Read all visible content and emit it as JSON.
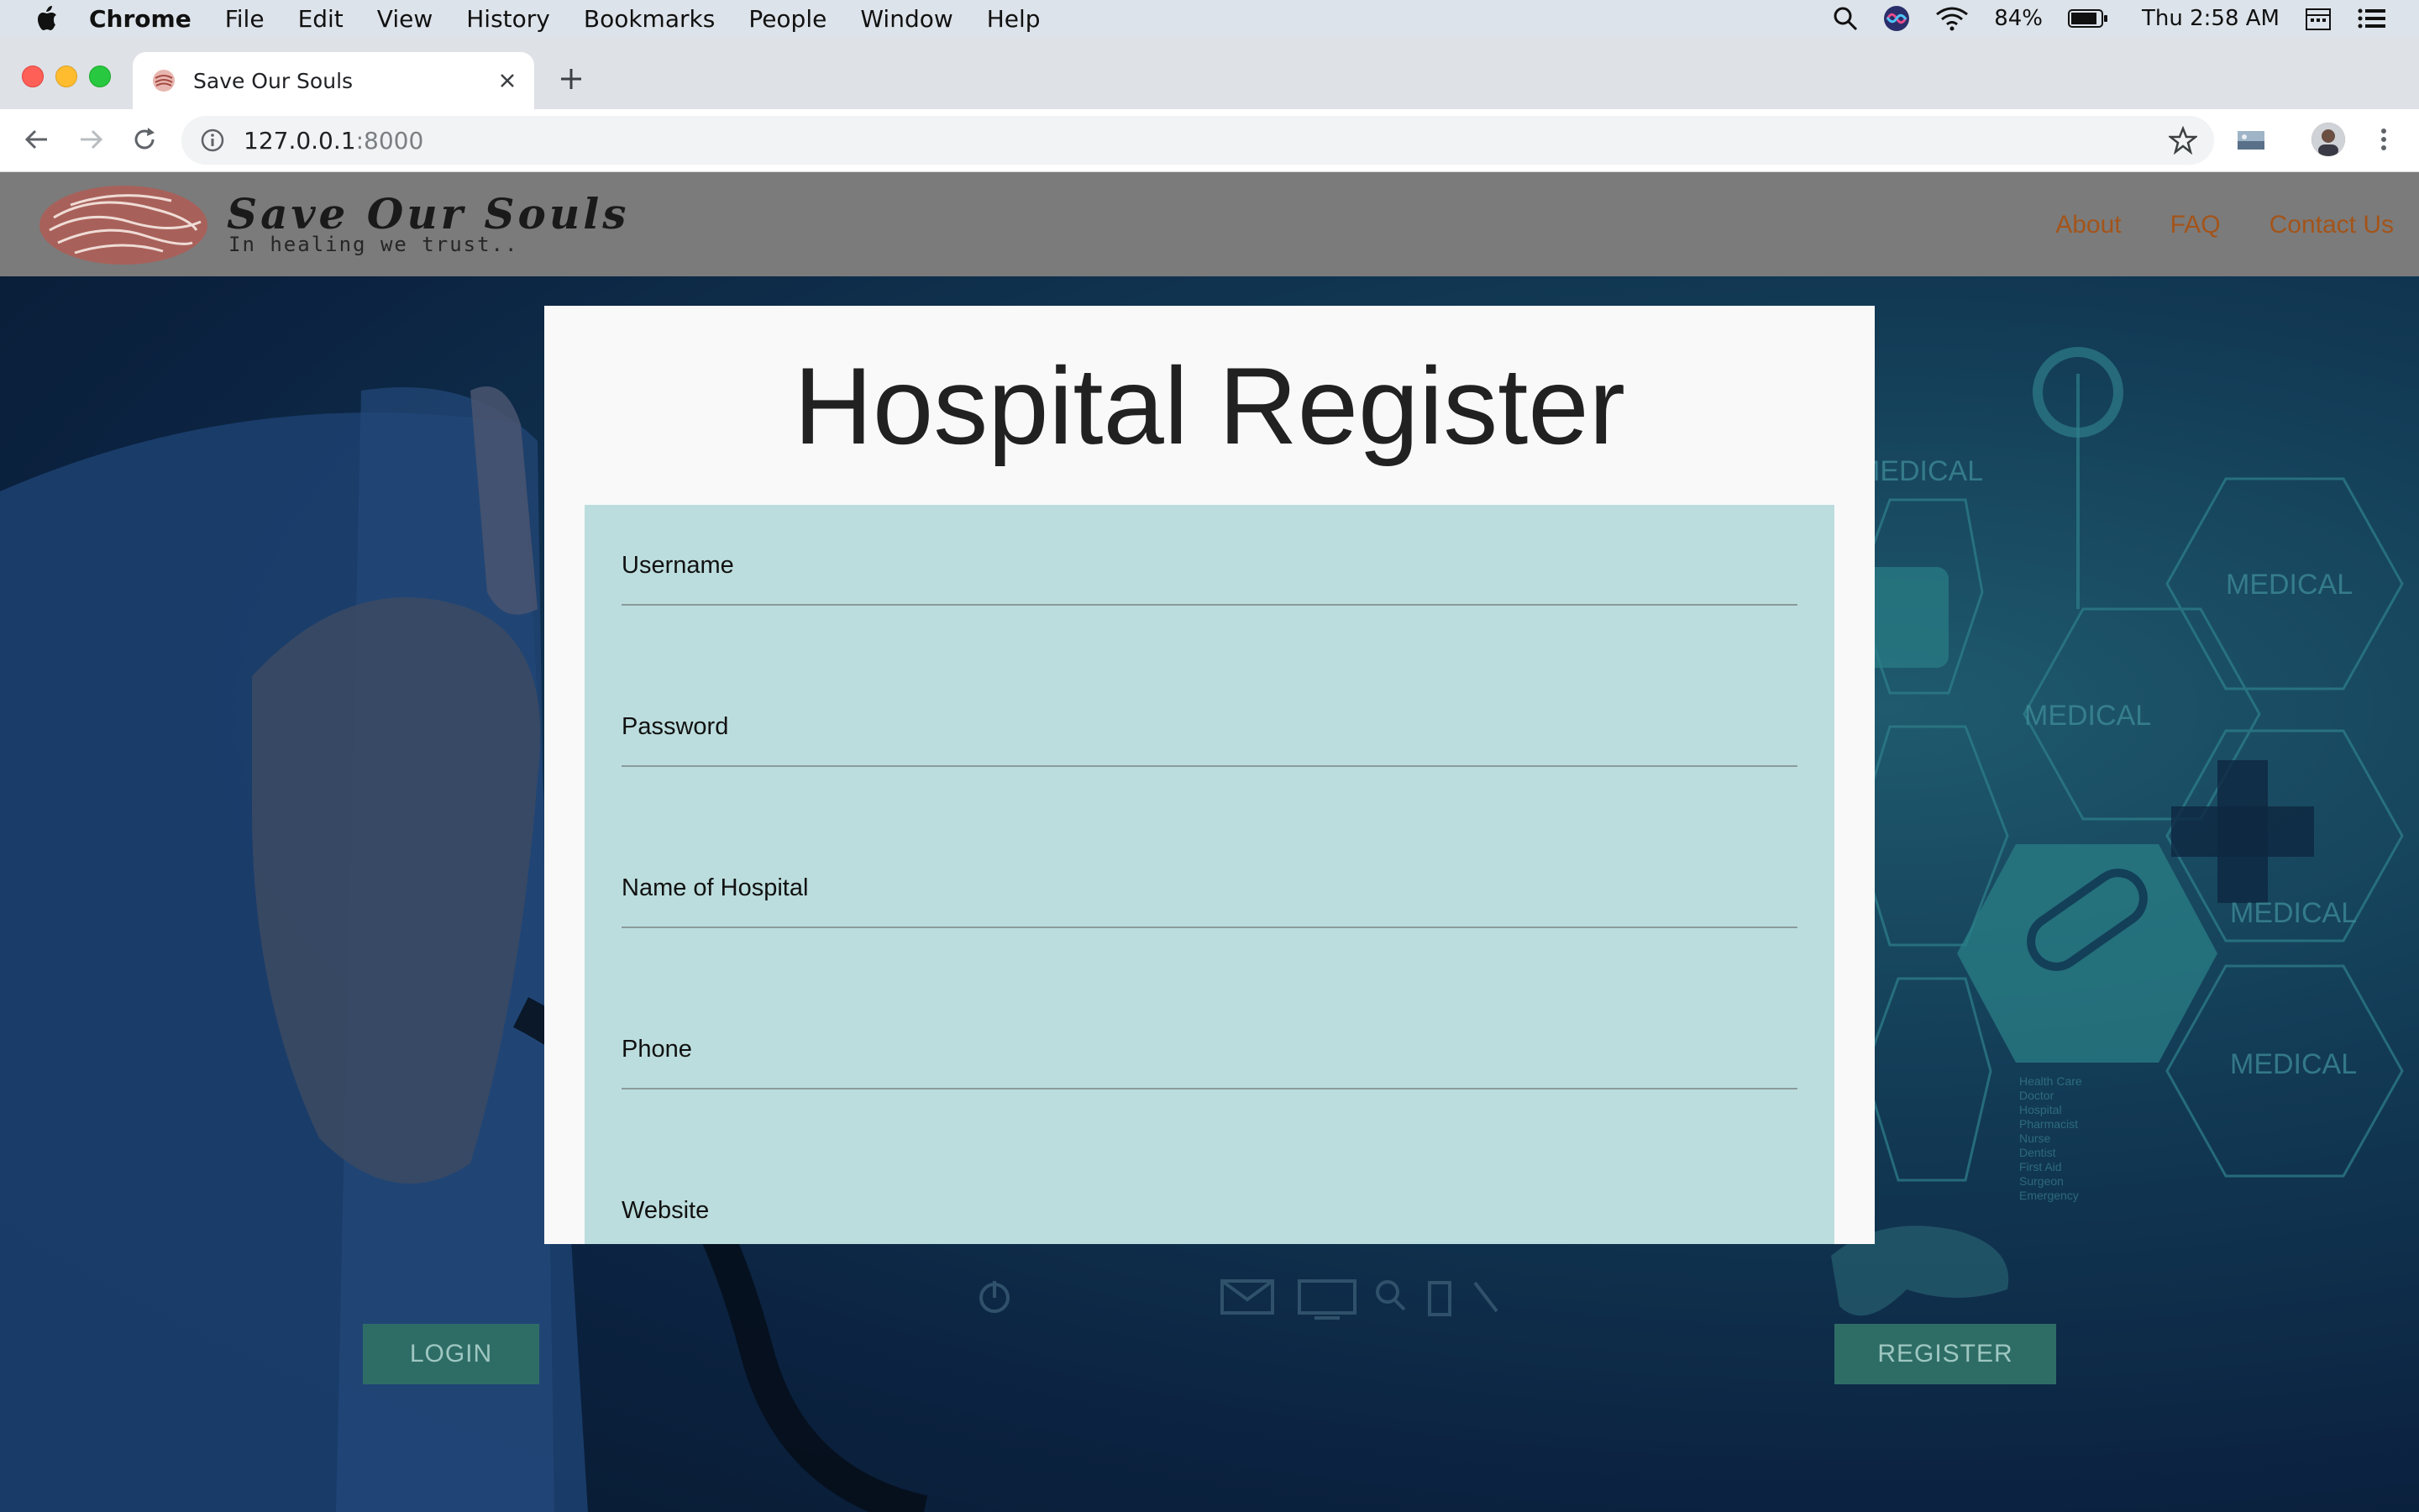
{
  "menubar": {
    "app_name": "Chrome",
    "items": [
      "File",
      "Edit",
      "View",
      "History",
      "Bookmarks",
      "People",
      "Window",
      "Help"
    ],
    "battery": "84%",
    "clock": "Thu 2:58 AM"
  },
  "browser": {
    "tab_title": "Save Our Souls",
    "url_host": "127.0.0.1",
    "url_port": ":8000"
  },
  "site": {
    "logo_title": "Save Our Souls",
    "logo_tagline": "In healing we trust..",
    "nav": [
      "About",
      "FAQ",
      "Contact Us"
    ]
  },
  "modal": {
    "title": "Hospital Register",
    "fields": [
      {
        "label": "Username"
      },
      {
        "label": "Password"
      },
      {
        "label": "Name of Hospital"
      },
      {
        "label": "Phone"
      },
      {
        "label": "Website"
      }
    ]
  },
  "background": {
    "hex_labels": [
      "MEDICAL",
      "MEDICAL",
      "MEDICAL",
      "MEDICAL",
      "MEDICAL"
    ],
    "side_list": [
      "Health Care",
      "Doctor",
      "Hospital",
      "Pharmacist",
      "Nurse",
      "Dentist",
      "First Aid",
      "Surgeon",
      "Emergency"
    ]
  },
  "buttons": {
    "login": "LOGIN",
    "register": "REGISTER"
  },
  "colors": {
    "header_bg": "#7b7b7b",
    "nav_link": "#a3541a",
    "form_panel": "#bcdddd",
    "button_bg": "#2e6d66"
  }
}
